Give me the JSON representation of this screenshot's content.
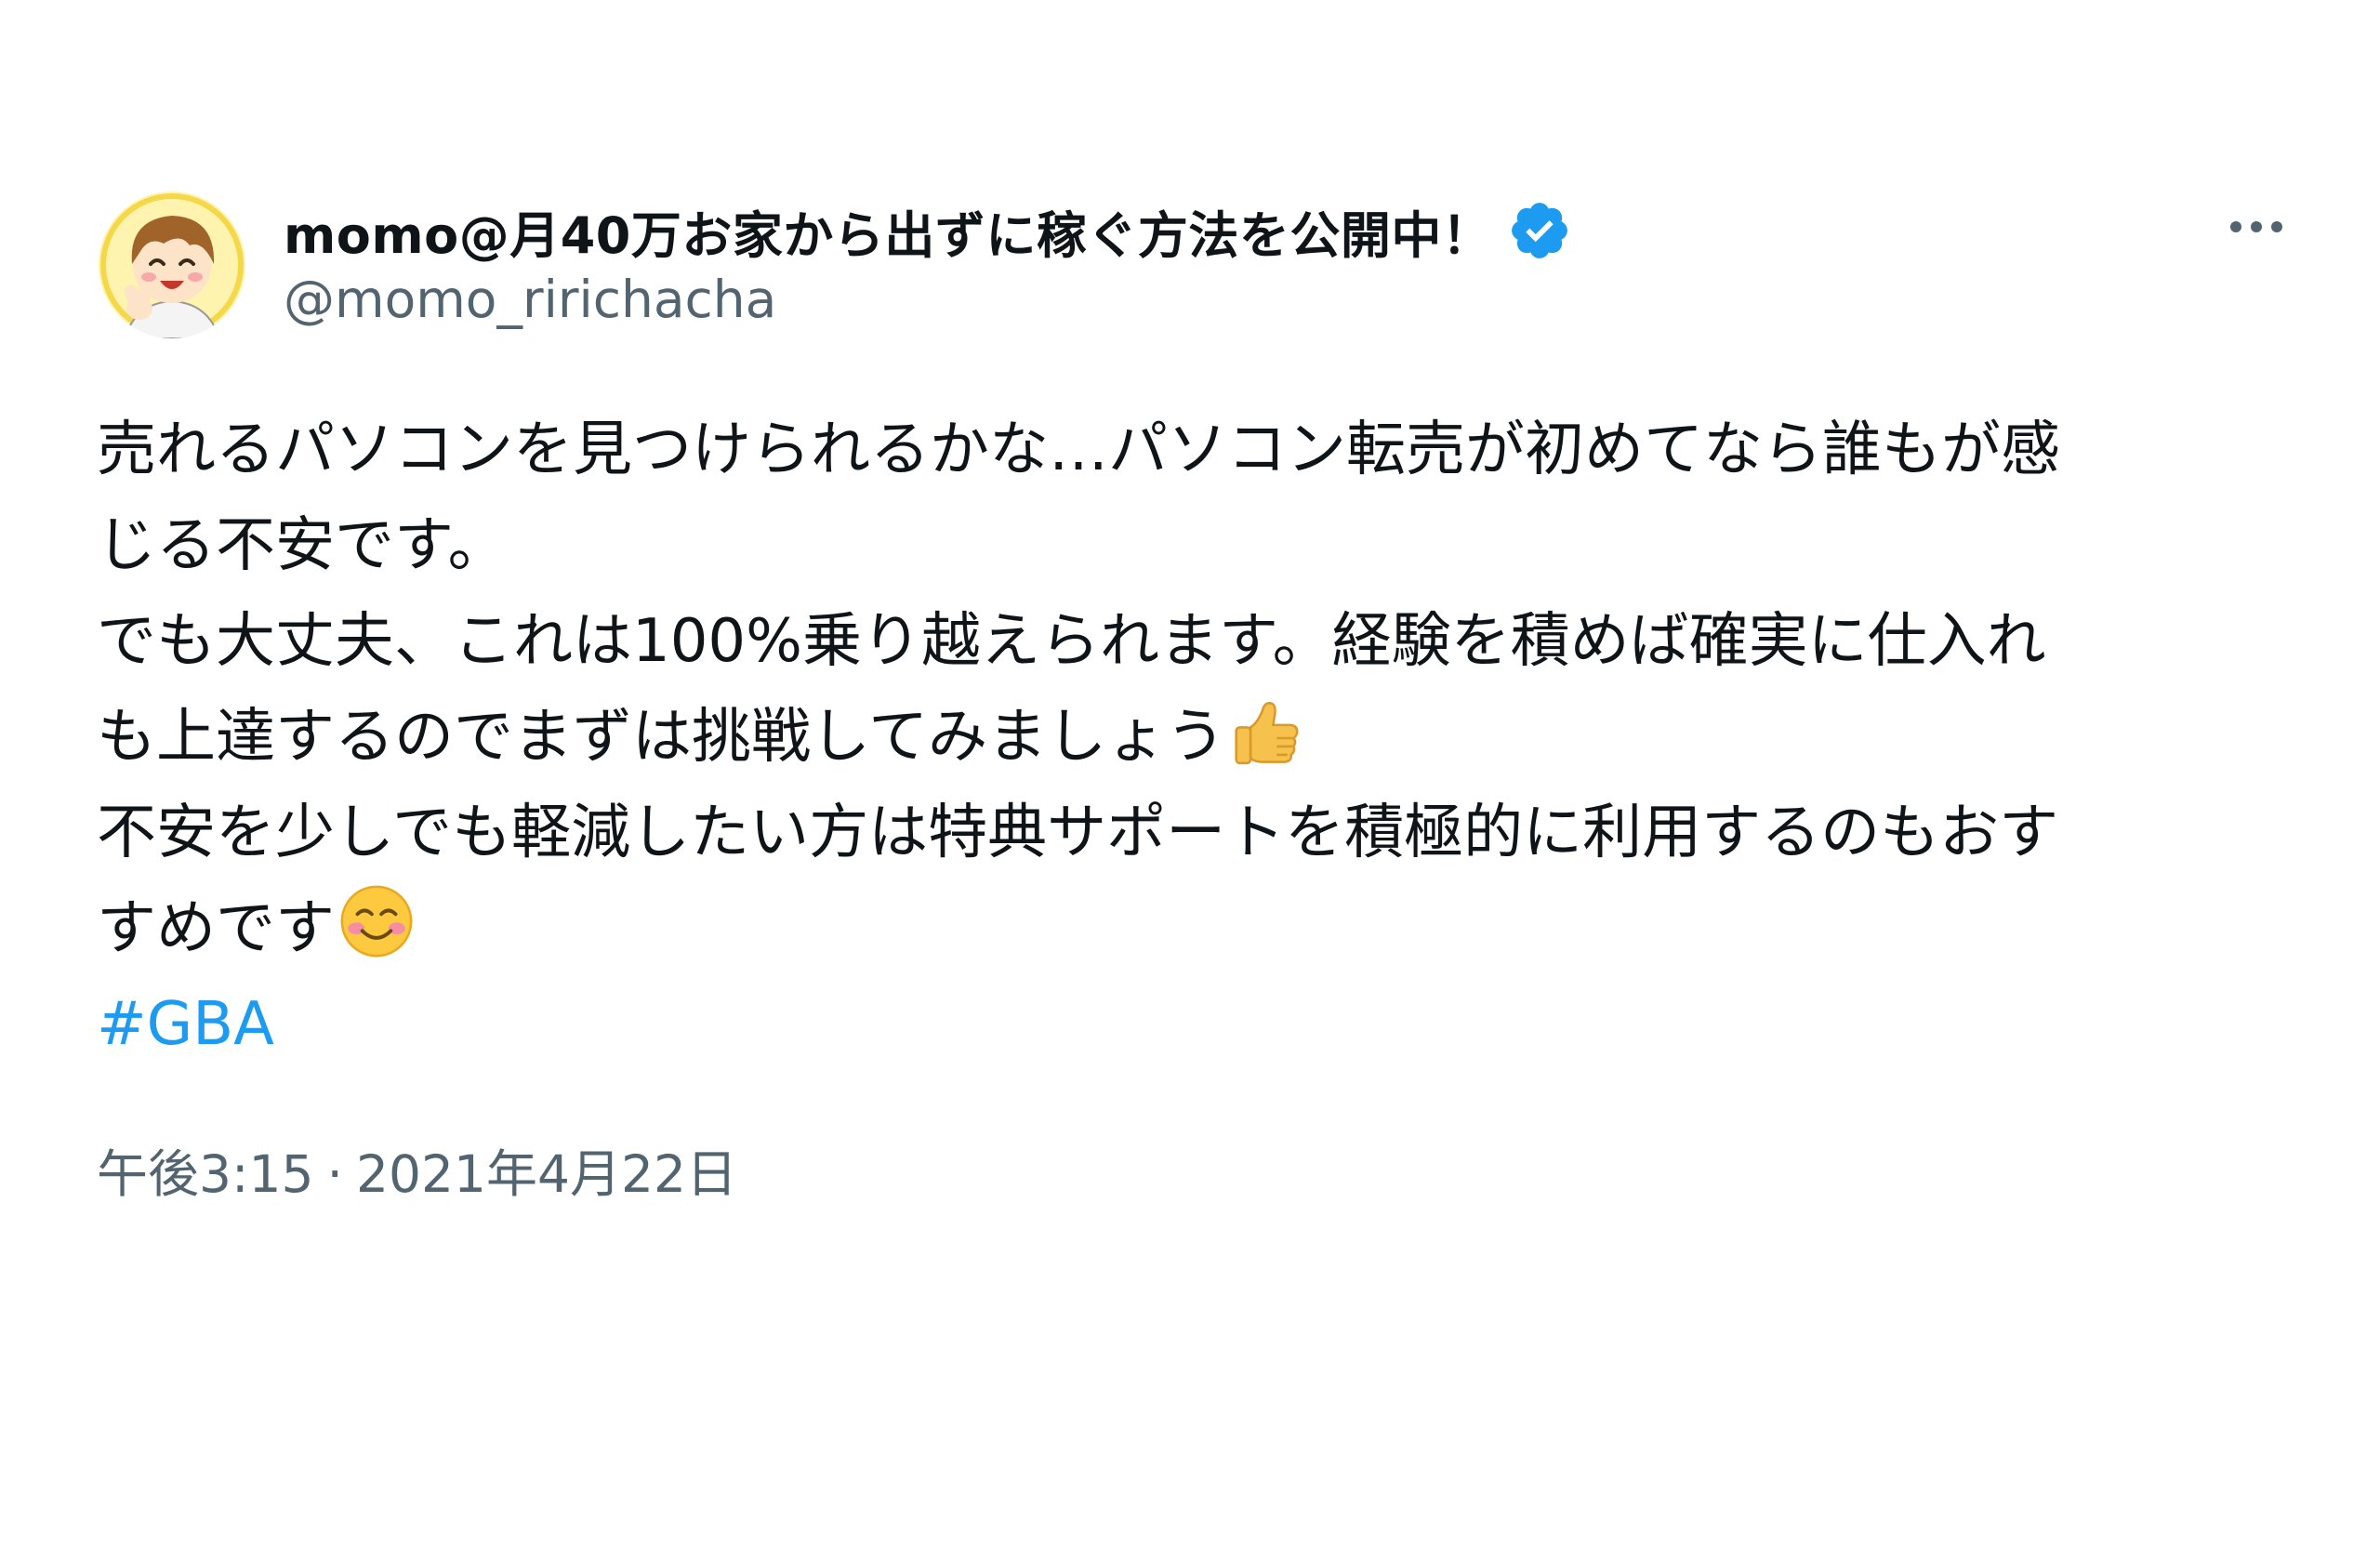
{
  "author": {
    "display_name": "momo@月40万お家から出ずに稼ぐ方法を公開中！",
    "handle": "@momo_ririchacha",
    "verified": true,
    "avatar_icon": "avatar-cartoon-boy-peace-sign"
  },
  "more_icon": "more-horizontal-icon",
  "tweet": {
    "lines": [
      "売れるパソコンを見つけられるかな…パソコン転売が初めてなら誰もが感",
      "じる不安です。",
      "でも大丈夫、これは100%乗り越えられます。経験を積めば確実に仕入れ",
      "も上達するのでまずは挑戦してみましょう",
      "不安を少しでも軽減したい方は特典サポートを積極的に利用するのもおす",
      "すめです"
    ],
    "emoji_after_line_4": "thumbs-up-emoji",
    "emoji_after_line_6": "smiling-face-emoji",
    "hashtag": "#GBA"
  },
  "meta": {
    "time": "午後3:15",
    "separator": "·",
    "date": "2021年4月22日"
  },
  "colors": {
    "text": "#0f1419",
    "secondary": "#536471",
    "link": "#1d9bf0",
    "verified": "#1d9bf0"
  }
}
